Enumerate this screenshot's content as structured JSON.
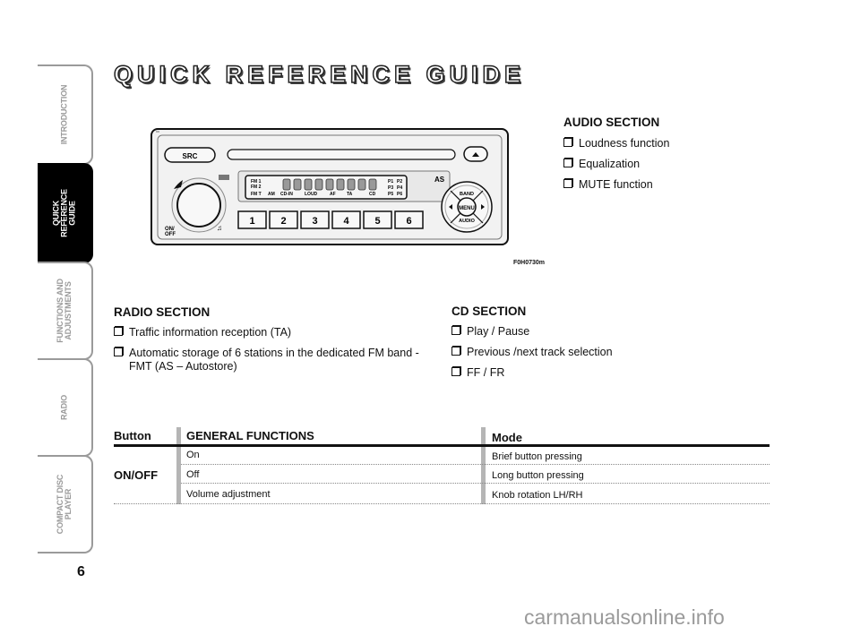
{
  "sidebar": {
    "tabs": [
      {
        "label": "INTRODUCTION",
        "active": false
      },
      {
        "label": "QUICK\nREFERENCE\nGUIDE",
        "active": true
      },
      {
        "label": "FUNCTIONS AND\nADJUSTMENTS",
        "active": false
      },
      {
        "label": "RADIO",
        "active": false
      },
      {
        "label": "COMPACT DISC\nPLAYER",
        "active": false
      }
    ],
    "page_number": "6"
  },
  "title": "QUICK REFERENCE GUIDE",
  "figure": {
    "code": "F0H0730m",
    "labels": {
      "src": "SRC",
      "on_off": "ON/\nOFF",
      "as": "AS",
      "band": "BAND",
      "menu": "MENU",
      "audio": "AUDIO",
      "fm1": "FM 1",
      "fm2": "FM 2",
      "fmt": "FM T",
      "am": "AM",
      "cdin": "CD-IN",
      "loud": "LOUD",
      "af": "AF",
      "ta": "TA",
      "cd": "CD",
      "presets_display": [
        "P1",
        "P2",
        "P3",
        "P4",
        "P5",
        "P6"
      ],
      "preset_buttons": [
        "1",
        "2",
        "3",
        "4",
        "5",
        "6"
      ]
    }
  },
  "audio_section": {
    "heading": "AUDIO SECTION",
    "items": [
      "Loudness function",
      "Equalization",
      "MUTE function"
    ]
  },
  "radio_section": {
    "heading": "RADIO SECTION",
    "items": [
      "Traffic information reception (TA)",
      "Automatic storage of 6 stations in the dedicated FM band -",
      "FMT (AS – Autostore)"
    ]
  },
  "cd_section": {
    "heading": "CD SECTION",
    "items": [
      "Play / Pause",
      "Previous /next track selection",
      "FF / FR"
    ]
  },
  "table": {
    "headers": {
      "button": "Button",
      "functions": "GENERAL FUNCTIONS",
      "mode": "Mode"
    },
    "button": "ON/OFF",
    "rows": [
      {
        "function": "On",
        "mode": "Brief button pressing"
      },
      {
        "function": "Off",
        "mode": "Long button pressing"
      },
      {
        "function": "Volume adjustment",
        "mode": "Knob rotation LH/RH"
      }
    ]
  },
  "watermark": "carmanualsonline.info"
}
